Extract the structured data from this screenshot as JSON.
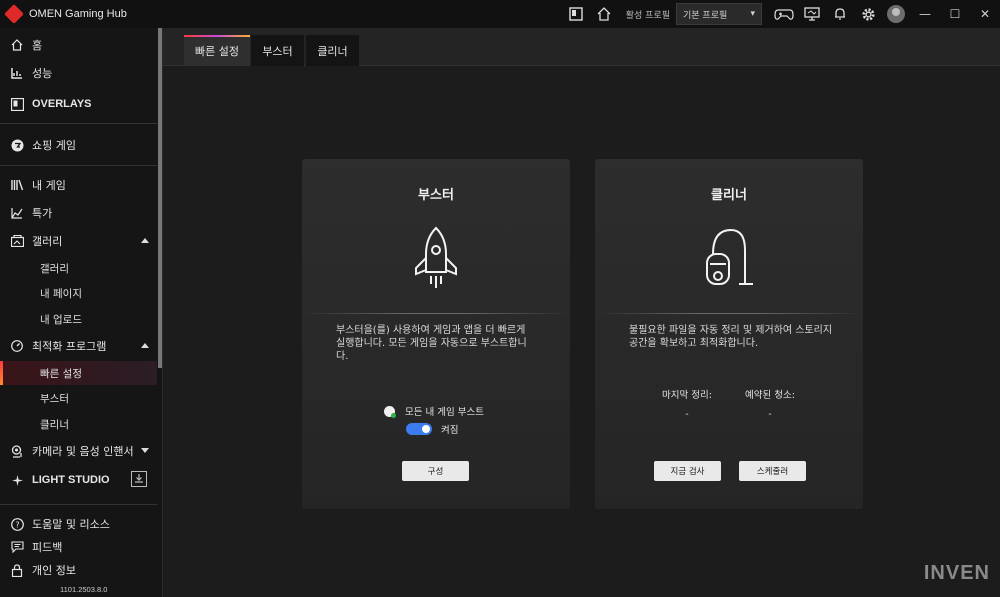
{
  "window": {
    "title": "OMEN Gaming Hub",
    "active_profile_label": "활성 프로필",
    "profile_value": "기본 프로필",
    "controls": [
      "minimize",
      "maximize",
      "close"
    ]
  },
  "sidebar": {
    "items": [
      {
        "label": "홈",
        "icon": "home-icon"
      },
      {
        "label": "성능",
        "icon": "performance-icon"
      },
      {
        "label": "OVERLAYS",
        "icon": "overlays-icon"
      },
      {
        "label": "쇼핑 게임",
        "icon": "shopping-icon"
      },
      {
        "label": "내 게임",
        "icon": "library-icon"
      },
      {
        "label": "특가",
        "icon": "deals-icon"
      },
      {
        "label": "갤러리",
        "icon": "gallery-icon"
      },
      {
        "label": "최적화 프로그램",
        "icon": "optimizer-icon"
      },
      {
        "label": "카메라 및 음성 인핸서",
        "icon": "camera-icon"
      },
      {
        "label": "LIGHT STUDIO",
        "icon": "light-studio-icon"
      },
      {
        "label": "도움말 및 리소스",
        "icon": "help-icon"
      },
      {
        "label": "피드백",
        "icon": "feedback-icon"
      },
      {
        "label": "개인 정보",
        "icon": "privacy-icon"
      }
    ],
    "gallery_sub": [
      "갤러리",
      "내 페이지",
      "내 업로드"
    ],
    "optimizer_sub": [
      "빠른 설정",
      "부스터",
      "클리너"
    ],
    "version": "1101.2503.8.0"
  },
  "tabs": [
    "빠른 설정",
    "부스터",
    "클리너"
  ],
  "booster_card": {
    "title": "부스터",
    "description": "부스터을(를) 사용하여 게임과 앱을 더 빠르게 실행합니다. 모든 게임을 자동으로 부스트합니다.",
    "boost_all_label": "모든 내 게임 부스트",
    "toggle_label": "켜짐",
    "toggle_on": true,
    "configure_button": "구성"
  },
  "cleaner_card": {
    "title": "클리너",
    "description": "불필요한 파일을 자동 정리 및 제거하여 스토리지 공간을 확보하고 최적화합니다.",
    "last_clean_label": "마지막 정리:",
    "last_clean_value": "-",
    "scheduled_clean_label": "예약된 청소:",
    "scheduled_clean_value": "-",
    "scan_button": "지금 검사",
    "scheduler_button": "스케줄러"
  },
  "watermark": "INVEN",
  "colors": {
    "accent_red": "#e02a2a",
    "toggle_blue": "#3d7bf0"
  }
}
